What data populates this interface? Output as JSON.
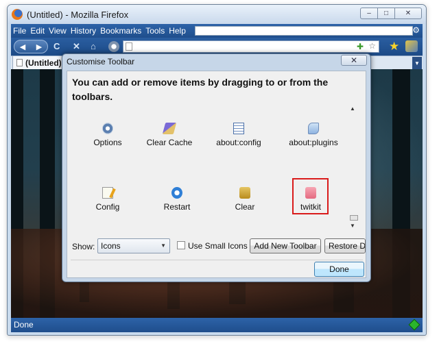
{
  "window": {
    "title": "(Untitled) - Mozilla Firefox",
    "minimize_label": "–",
    "maximize_label": "□",
    "close_label": "✕"
  },
  "menubar": {
    "items": [
      "File",
      "Edit",
      "View",
      "History",
      "Bookmarks",
      "Tools",
      "Help"
    ]
  },
  "navbar": {
    "back_label": "◀",
    "forward_label": "▶",
    "reload_label": "C",
    "stop_label": "✕",
    "home_label": "⌂",
    "url_value": "",
    "url_addon_icon": "puzzle-icon",
    "url_star_label": "☆",
    "bookmark_star_label": "★"
  },
  "tabbar": {
    "active_tab": "(Untitled)",
    "list_arrow": "▼"
  },
  "statusbar": {
    "text": "Done"
  },
  "dialog": {
    "title": "Customise Toolbar",
    "close_label": "✕",
    "instructions": "You can add or remove items by dragging to or from the toolbars.",
    "palette_items": [
      {
        "label": "Options",
        "icon": "options-icon"
      },
      {
        "label": "Clear Cache",
        "icon": "clear-cache-icon"
      },
      {
        "label": "about:config",
        "icon": "about-config-icon"
      },
      {
        "label": "about:plugins",
        "icon": "about-plugins-icon"
      },
      {
        "label": "Config",
        "icon": "config-icon"
      },
      {
        "label": "Restart",
        "icon": "restart-icon"
      },
      {
        "label": "Clear",
        "icon": "clear-icon"
      },
      {
        "label": "twitkit",
        "icon": "twitkit-icon"
      }
    ],
    "highlight_color": "#d91a1a",
    "show_label": "Show:",
    "show_selected": "Icons",
    "small_icons_label": "Use Small Icons",
    "small_icons_checked": false,
    "add_toolbar_label": "Add New Toolbar",
    "restore_label": "Restore De",
    "done_label": "Done",
    "scroll_up": "▲",
    "scroll_down": "▼",
    "select_arrow": "▼"
  }
}
